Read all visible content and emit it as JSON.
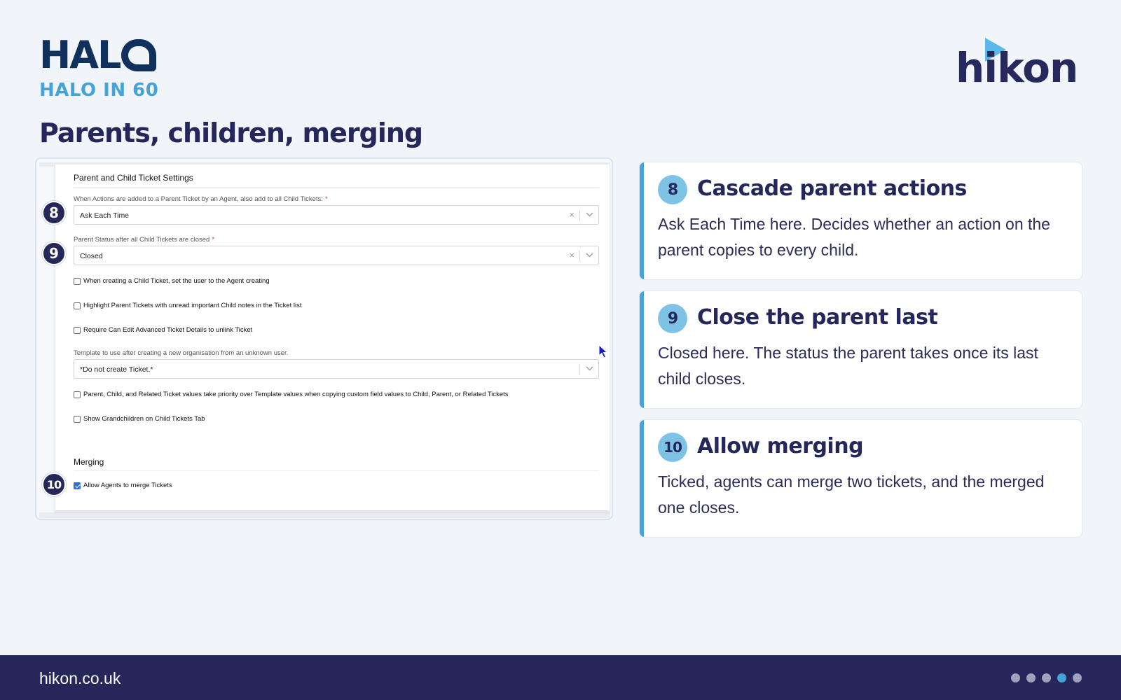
{
  "header": {
    "brand_word": "HAL",
    "brand_subtitle": "HALO IN 60",
    "partner_word": "hikon",
    "page_title": "Parents, children, merging"
  },
  "screenshot": {
    "section_parent_child": "Parent and Child Ticket Settings",
    "field_cascade_label": "When Actions are added to a Parent Ticket by an Agent, also add to all Child Tickets:",
    "field_cascade_value": "Ask Each Time",
    "field_status_label": "Parent Status after all Child Tickets are closed",
    "field_status_value": "Closed",
    "required_mark": "*",
    "clear_symbol": "×",
    "check_user_agent": "When creating a Child Ticket, set the user to the Agent creating",
    "check_highlight": "Highlight Parent Tickets with unread important Child notes in the Ticket list",
    "check_require_edit": "Require Can Edit Advanced Ticket Details to unlink Ticket",
    "field_template_label": "Template to use after creating a new organisation from an unknown user.",
    "field_template_value": "*Do not create Ticket.*",
    "check_priority": "Parent, Child, and Related Ticket values take priority over Template values when copying custom field values to Child, Parent, or Related Tickets",
    "check_grandchildren": "Show Grandchildren on Child Tickets Tab",
    "section_merging": "Merging",
    "check_allow_merge": "Allow Agents to merge Tickets",
    "allow_merge_checked": true,
    "badges": [
      "8",
      "9",
      "10"
    ]
  },
  "callouts": [
    {
      "number": "8",
      "title": "Cascade parent actions",
      "body": "Ask Each Time here. Decides whether an action on the parent copies to every child."
    },
    {
      "number": "9",
      "title": "Close the parent last",
      "body": "Closed here. The status the parent takes once its last child closes."
    },
    {
      "number": "10",
      "title": "Allow merging",
      "body": "Ticked, agents can merge two tickets, and the merged one closes."
    }
  ],
  "footer": {
    "link": "hikon.co.uk",
    "pagination_total": 5,
    "pagination_active": 4
  },
  "colors": {
    "navy": "#25275a",
    "accent": "#44a3d8",
    "badge_light": "#7ec3e6",
    "background": "#f1f4f9"
  }
}
